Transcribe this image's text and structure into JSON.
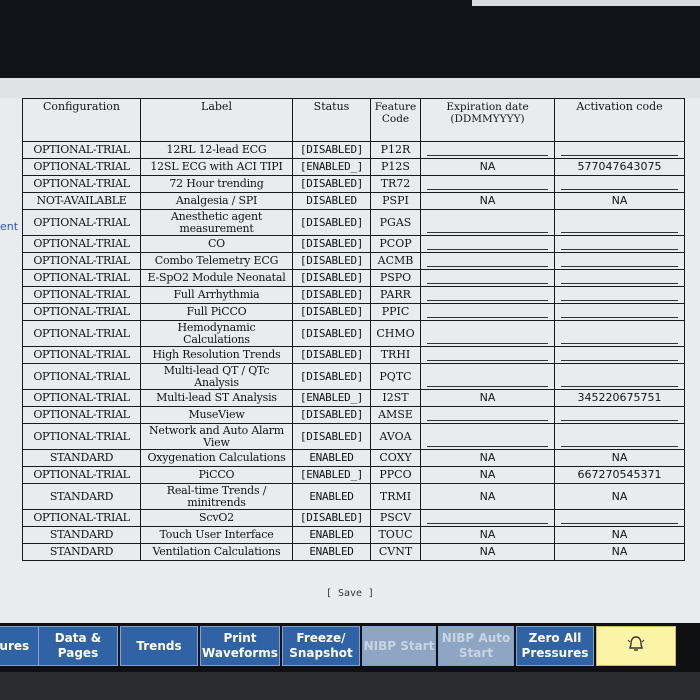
{
  "side_label": "ent",
  "headers": {
    "configuration": "Configuration",
    "label": "Label",
    "status": "Status",
    "feature_code": "Feature Code",
    "expiration": "Expiration date (DDMMYYYY)",
    "activation": "Activation code"
  },
  "rows": [
    {
      "cfg": "OPTIONAL-TRIAL",
      "label": "12RL 12-lead ECG",
      "status": "[DISABLED]",
      "code": "P12R",
      "exp": "",
      "act": ""
    },
    {
      "cfg": "OPTIONAL-TRIAL",
      "label": "12SL ECG with ACI TIPI",
      "status": "[ENABLED_]",
      "code": "P12S",
      "exp": "NA",
      "act": "577047643075"
    },
    {
      "cfg": "OPTIONAL-TRIAL",
      "label": "72 Hour trending",
      "status": "[DISABLED]",
      "code": "TR72",
      "exp": "",
      "act": ""
    },
    {
      "cfg": "NOT-AVAILABLE",
      "label": "Analgesia / SPI",
      "status": "DISABLED",
      "code": "PSPI",
      "exp": "NA",
      "act": "NA"
    },
    {
      "cfg": "OPTIONAL-TRIAL",
      "label": "Anesthetic agent measurement",
      "status": "[DISABLED]",
      "code": "PGAS",
      "exp": "",
      "act": ""
    },
    {
      "cfg": "OPTIONAL-TRIAL",
      "label": "CO",
      "status": "[DISABLED]",
      "code": "PCOP",
      "exp": "",
      "act": ""
    },
    {
      "cfg": "OPTIONAL-TRIAL",
      "label": "Combo Telemetry ECG",
      "status": "[DISABLED]",
      "code": "ACMB",
      "exp": "",
      "act": ""
    },
    {
      "cfg": "OPTIONAL-TRIAL",
      "label": "E-SpO2 Module Neonatal",
      "status": "[DISABLED]",
      "code": "PSPO",
      "exp": "",
      "act": ""
    },
    {
      "cfg": "OPTIONAL-TRIAL",
      "label": "Full Arrhythmia",
      "status": "[DISABLED]",
      "code": "PARR",
      "exp": "",
      "act": ""
    },
    {
      "cfg": "OPTIONAL-TRIAL",
      "label": "Full PiCCO",
      "status": "[DISABLED]",
      "code": "PPIC",
      "exp": "",
      "act": ""
    },
    {
      "cfg": "OPTIONAL-TRIAL",
      "label": "Hemodynamic Calculations",
      "status": "[DISABLED]",
      "code": "CHMO",
      "exp": "",
      "act": ""
    },
    {
      "cfg": "OPTIONAL-TRIAL",
      "label": "High Resolution Trends",
      "status": "[DISABLED]",
      "code": "TRHI",
      "exp": "",
      "act": ""
    },
    {
      "cfg": "OPTIONAL-TRIAL",
      "label": "Multi-lead QT / QTc Analysis",
      "status": "[DISABLED]",
      "code": "PQTC",
      "exp": "",
      "act": ""
    },
    {
      "cfg": "OPTIONAL-TRIAL",
      "label": "Multi-lead ST Analysis",
      "status": "[ENABLED_]",
      "code": "I2ST",
      "exp": "NA",
      "act": "345220675751"
    },
    {
      "cfg": "OPTIONAL-TRIAL",
      "label": "MuseView",
      "status": "[DISABLED]",
      "code": "AMSE",
      "exp": "",
      "act": ""
    },
    {
      "cfg": "OPTIONAL-TRIAL",
      "label": "Network and Auto Alarm View",
      "status": "[DISABLED]",
      "code": "AVOA",
      "exp": "",
      "act": ""
    },
    {
      "cfg": "STANDARD",
      "label": "Oxygenation Calculations",
      "status": "ENABLED",
      "code": "COXY",
      "exp": "NA",
      "act": "NA"
    },
    {
      "cfg": "OPTIONAL-TRIAL",
      "label": "PiCCO",
      "status": "[ENABLED_]",
      "code": "PPCO",
      "exp": "NA",
      "act": "667270545371"
    },
    {
      "cfg": "STANDARD",
      "label": "Real-time Trends / minitrends",
      "status": "ENABLED",
      "code": "TRMI",
      "exp": "NA",
      "act": "NA"
    },
    {
      "cfg": "OPTIONAL-TRIAL",
      "label": "ScvO2",
      "status": "[DISABLED]",
      "code": "PSCV",
      "exp": "",
      "act": ""
    },
    {
      "cfg": "STANDARD",
      "label": "Touch User Interface",
      "status": "ENABLED",
      "code": "TOUC",
      "exp": "NA",
      "act": "NA"
    },
    {
      "cfg": "STANDARD",
      "label": "Ventilation Calculations",
      "status": "ENABLED",
      "code": "CVNT",
      "exp": "NA",
      "act": "NA"
    }
  ],
  "save_label": "[ Save ]",
  "softkeys": [
    {
      "label": "dures",
      "dim": false
    },
    {
      "label": "Data & Pages",
      "dim": false
    },
    {
      "label": "Trends",
      "dim": false
    },
    {
      "label": "Print Waveforms",
      "dim": false
    },
    {
      "label": "Freeze/ Snapshot",
      "dim": false
    },
    {
      "label": "NIBP Start",
      "dim": true
    },
    {
      "label": "NIBP Auto Start",
      "dim": true
    },
    {
      "label": "Zero All Pressures",
      "dim": false
    },
    {
      "label": "",
      "alarm": true,
      "icon": "alarm-bell-icon"
    }
  ]
}
